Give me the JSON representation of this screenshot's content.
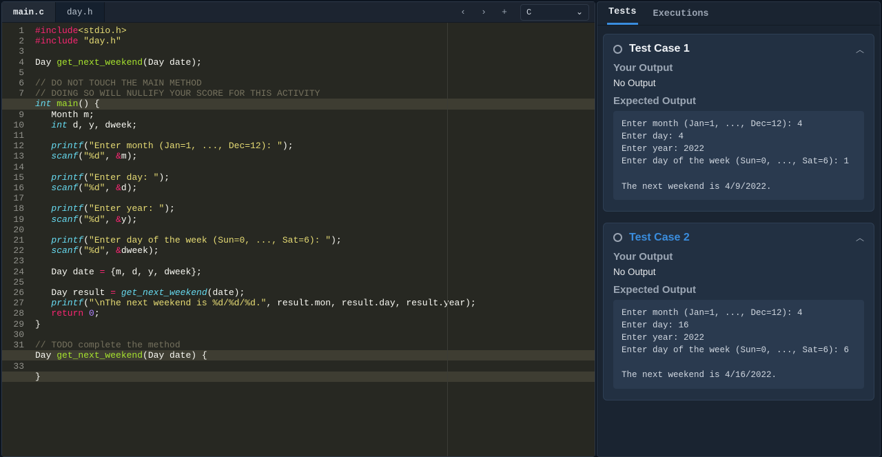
{
  "tabs": [
    {
      "label": "main.c",
      "active": true
    },
    {
      "label": "day.h",
      "active": false
    }
  ],
  "nav": {
    "prev": "‹",
    "next": "›",
    "add": "+"
  },
  "lang": {
    "label": "C",
    "chev": "⌄"
  },
  "side_tabs": [
    {
      "label": "Tests",
      "active": true
    },
    {
      "label": "Executions",
      "active": false
    }
  ],
  "lines_count": 34,
  "code": [
    [
      [
        "#include",
        "pink"
      ],
      [
        "<stdio.h>",
        "yellow"
      ]
    ],
    [
      [
        "#include ",
        "pink"
      ],
      [
        "\"day.h\"",
        "yellow"
      ]
    ],
    [
      [
        "",
        ""
      ]
    ],
    [
      [
        "Day ",
        "white"
      ],
      [
        "get_next_weekend",
        "green"
      ],
      [
        "(Day date);",
        "white"
      ]
    ],
    [
      [
        "",
        ""
      ]
    ],
    [
      [
        "// DO NOT TOUCH THE MAIN METHOD",
        "gray"
      ]
    ],
    [
      [
        "// DOING SO WILL NULLIFY YOUR SCORE FOR THIS ACTIVITY",
        "gray"
      ]
    ],
    [
      [
        "int",
        "blue"
      ],
      [
        " ",
        "white"
      ],
      [
        "main",
        "green"
      ],
      [
        "() {",
        "white"
      ]
    ],
    [
      [
        "   Month m;",
        "white"
      ]
    ],
    [
      [
        "   ",
        "white"
      ],
      [
        "int",
        "blue"
      ],
      [
        " d, y, dweek;",
        "white"
      ]
    ],
    [
      [
        "",
        ""
      ]
    ],
    [
      [
        "   ",
        "white"
      ],
      [
        "printf",
        "blue"
      ],
      [
        "(",
        "white"
      ],
      [
        "\"Enter month (Jan=1, ..., Dec=12): \"",
        "yellow"
      ],
      [
        ");",
        "white"
      ]
    ],
    [
      [
        "   ",
        "white"
      ],
      [
        "scanf",
        "blue"
      ],
      [
        "(",
        "white"
      ],
      [
        "\"%d\"",
        "yellow"
      ],
      [
        ", ",
        "white"
      ],
      [
        "&",
        "pink"
      ],
      [
        "m",
        "white"
      ],
      [
        ");",
        "white"
      ]
    ],
    [
      [
        "",
        ""
      ]
    ],
    [
      [
        "   ",
        "white"
      ],
      [
        "printf",
        "blue"
      ],
      [
        "(",
        "white"
      ],
      [
        "\"Enter day: \"",
        "yellow"
      ],
      [
        ");",
        "white"
      ]
    ],
    [
      [
        "   ",
        "white"
      ],
      [
        "scanf",
        "blue"
      ],
      [
        "(",
        "white"
      ],
      [
        "\"%d\"",
        "yellow"
      ],
      [
        ", ",
        "white"
      ],
      [
        "&",
        "pink"
      ],
      [
        "d",
        "white"
      ],
      [
        ");",
        "white"
      ]
    ],
    [
      [
        "",
        ""
      ]
    ],
    [
      [
        "   ",
        "white"
      ],
      [
        "printf",
        "blue"
      ],
      [
        "(",
        "white"
      ],
      [
        "\"Enter year: \"",
        "yellow"
      ],
      [
        ");",
        "white"
      ]
    ],
    [
      [
        "   ",
        "white"
      ],
      [
        "scanf",
        "blue"
      ],
      [
        "(",
        "white"
      ],
      [
        "\"%d\"",
        "yellow"
      ],
      [
        ", ",
        "white"
      ],
      [
        "&",
        "pink"
      ],
      [
        "y",
        "white"
      ],
      [
        ");",
        "white"
      ]
    ],
    [
      [
        "",
        ""
      ]
    ],
    [
      [
        "   ",
        "white"
      ],
      [
        "printf",
        "blue"
      ],
      [
        "(",
        "white"
      ],
      [
        "\"Enter day of the week (Sun=0, ..., Sat=6): \"",
        "yellow"
      ],
      [
        ");",
        "white"
      ]
    ],
    [
      [
        "   ",
        "white"
      ],
      [
        "scanf",
        "blue"
      ],
      [
        "(",
        "white"
      ],
      [
        "\"%d\"",
        "yellow"
      ],
      [
        ", ",
        "white"
      ],
      [
        "&",
        "pink"
      ],
      [
        "dweek",
        "white"
      ],
      [
        ");",
        "white"
      ]
    ],
    [
      [
        "",
        ""
      ]
    ],
    [
      [
        "   Day date ",
        "white"
      ],
      [
        "=",
        "pink"
      ],
      [
        " {m, d, y, dweek};",
        "white"
      ]
    ],
    [
      [
        "",
        ""
      ]
    ],
    [
      [
        "   Day result ",
        "white"
      ],
      [
        "=",
        "pink"
      ],
      [
        " ",
        "white"
      ],
      [
        "get_next_weekend",
        "blue"
      ],
      [
        "(date);",
        "white"
      ]
    ],
    [
      [
        "   ",
        "white"
      ],
      [
        "printf",
        "blue"
      ],
      [
        "(",
        "white"
      ],
      [
        "\"\\nThe next weekend is %d/%d/%d.\"",
        "yellow"
      ],
      [
        ", result.mon, result.day, result.year);",
        "white"
      ]
    ],
    [
      [
        "   ",
        "white"
      ],
      [
        "return",
        "pink"
      ],
      [
        " ",
        "white"
      ],
      [
        "0",
        "num"
      ],
      [
        ";",
        "white"
      ]
    ],
    [
      [
        "}",
        "white"
      ]
    ],
    [
      [
        "",
        ""
      ]
    ],
    [
      [
        "// TODO complete the method",
        "gray"
      ]
    ],
    [
      [
        "Day ",
        "white"
      ],
      [
        "get_next_weekend",
        "green"
      ],
      [
        "(Day date) {",
        "white"
      ]
    ],
    [
      [
        "",
        ""
      ]
    ],
    [
      [
        "}",
        "white"
      ]
    ]
  ],
  "test_cases": [
    {
      "title": "Test Case 1",
      "status": "neutral",
      "title_class": "pass",
      "your_output_label": "Your Output",
      "your_output": "No Output",
      "expected_label": "Expected Output",
      "expected": "Enter month (Jan=1, ..., Dec=12): 4\nEnter day: 4\nEnter year: 2022\nEnter day of the week (Sun=0, ..., Sat=6): 1\n\nThe next weekend is 4/9/2022."
    },
    {
      "title": "Test Case 2",
      "status": "neutral",
      "title_class": "current",
      "your_output_label": "Your Output",
      "your_output": "No Output",
      "expected_label": "Expected Output",
      "expected": "Enter month (Jan=1, ..., Dec=12): 4\nEnter day: 16\nEnter year: 2022\nEnter day of the week (Sun=0, ..., Sat=6): 6\n\nThe next weekend is 4/16/2022."
    }
  ]
}
